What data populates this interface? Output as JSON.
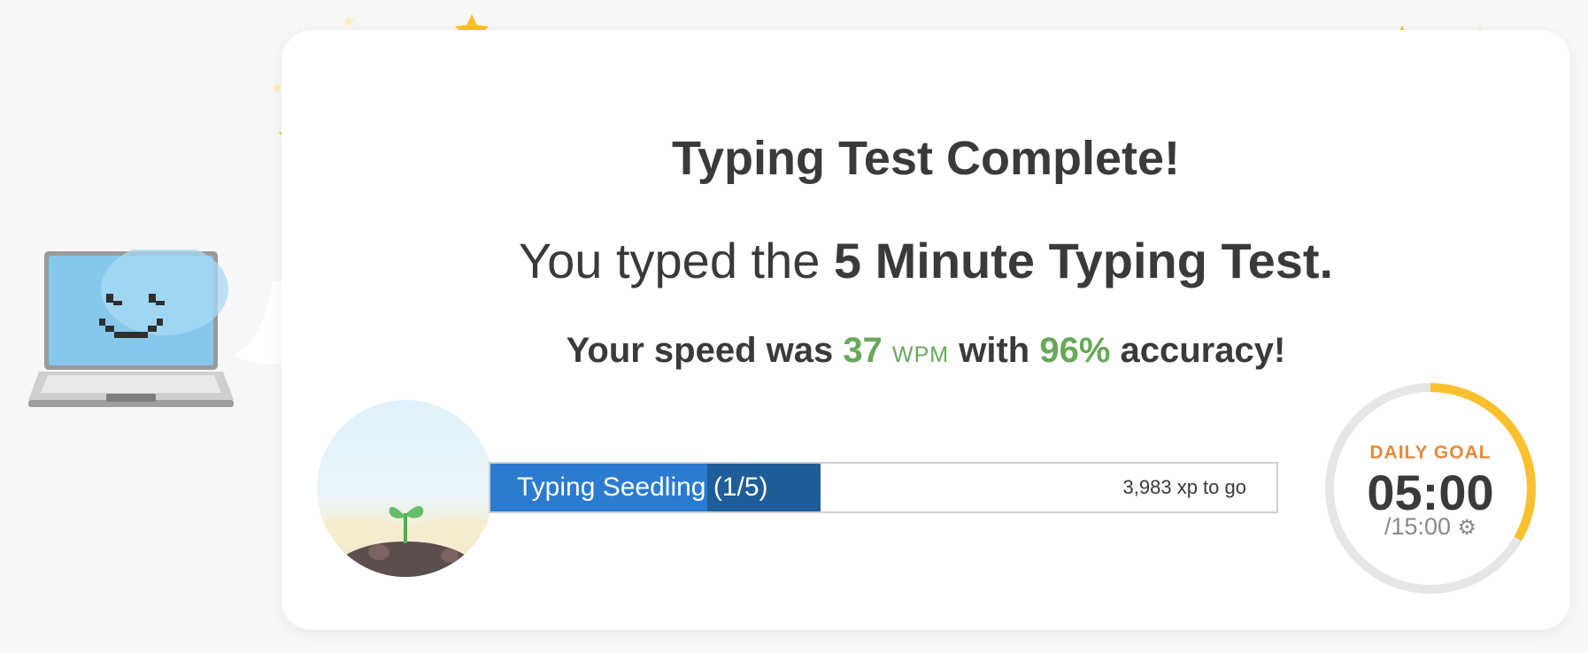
{
  "result": {
    "title": "Typing Test Complete!",
    "subtitle_prefix": "You typed the ",
    "test_name": "5 Minute Typing Test.",
    "speed_prefix": "Your speed was ",
    "wpm": "37",
    "wpm_unit": "WPM",
    "accuracy_prefix": " with ",
    "accuracy": "96%",
    "accuracy_suffix": " accuracy!"
  },
  "level": {
    "name": "Typing Seedling (1/5)",
    "xp_to_go": "3,983 xp to go",
    "progress_fraction": 0.42,
    "image": "seedling-sprout"
  },
  "daily_goal": {
    "label": "DAILY GOAL",
    "time": "05:00",
    "total": "/15:00",
    "progress_fraction": 0.333,
    "icon": "gear-icon"
  },
  "colors": {
    "accent_green": "#68a858",
    "progress_blue": "#2b7bd1",
    "progress_dark_blue": "#1f5d9a",
    "goal_orange": "#e58a3a",
    "goal_ring": "#fbc02d",
    "star": "#fbc02d"
  },
  "icons": [
    "laptop-mascot-icon",
    "star-icon",
    "gear-icon"
  ]
}
